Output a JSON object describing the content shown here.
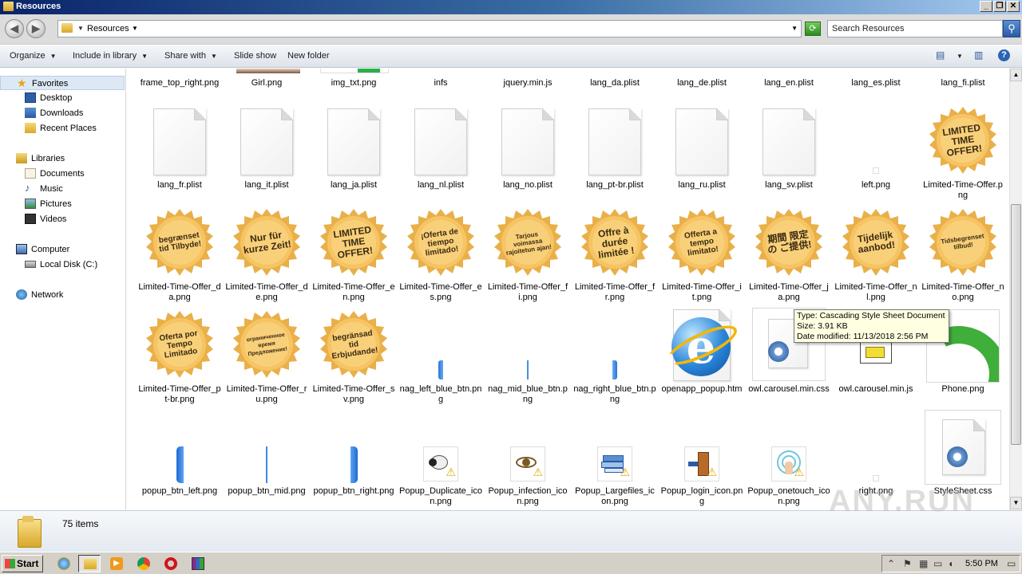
{
  "window": {
    "title": "Resources"
  },
  "address": {
    "crumb": "Resources",
    "search_placeholder": "Search Resources"
  },
  "toolbar": {
    "organize": "Organize",
    "include_in_library": "Include in library",
    "share_with": "Share with",
    "slide_show": "Slide show",
    "new_folder": "New folder"
  },
  "sidebar": {
    "favorites": "Favorites",
    "desktop": "Desktop",
    "downloads": "Downloads",
    "recent_places": "Recent Places",
    "libraries": "Libraries",
    "documents": "Documents",
    "music": "Music",
    "pictures": "Pictures",
    "videos": "Videos",
    "computer": "Computer",
    "local_disk": "Local Disk (C:)",
    "network": "Network"
  },
  "files": {
    "row0": [
      "frame_top_right.png",
      "Girl.png",
      "img_txt.png",
      "infs",
      "jquery.min.js",
      "lang_da.plist",
      "lang_de.plist",
      "lang_en.plist",
      "lang_es.plist",
      "lang_fi.plist"
    ],
    "row1": [
      "lang_fr.plist",
      "lang_it.plist",
      "lang_ja.plist",
      "lang_nl.plist",
      "lang_no.plist",
      "lang_pt-br.plist",
      "lang_ru.plist",
      "lang_sv.plist",
      "left.png",
      "Limited-Time-Offer.png"
    ],
    "row2": [
      "Limited-Time-Offer_da.png",
      "Limited-Time-Offer_de.png",
      "Limited-Time-Offer_en.png",
      "Limited-Time-Offer_es.png",
      "Limited-Time-Offer_fi.png",
      "Limited-Time-Offer_fr.png",
      "Limited-Time-Offer_it.png",
      "Limited-Time-Offer_ja.png",
      "Limited-Time-Offer_nl.png",
      "Limited-Time-Offer_no.png"
    ],
    "row3": [
      "Limited-Time-Offer_pt-br.png",
      "Limited-Time-Offer_ru.png",
      "Limited-Time-Offer_sv.png",
      "nag_left_blue_btn.png",
      "nag_mid_blue_btn.png",
      "nag_right_blue_btn.png",
      "openapp_popup.htm",
      "owl.carousel.min.css",
      "owl.carousel.min.js",
      "Phone.png"
    ],
    "row4": [
      "popup_btn_left.png",
      "popup_btn_mid.png",
      "popup_btn_right.png",
      "Popup_Duplicate_icon.png",
      "Popup_infection_icon.png",
      "Popup_Largefiles_icon.png",
      "Popup_login_icon.png",
      "Popup_onetouch_icon.png",
      "right.png",
      "StyleSheet.css"
    ]
  },
  "seals": {
    "main": "LIMITED TIME OFFER!",
    "row2": [
      "begrænset tid Tilbyde!",
      "Nur für kurze Zeit!",
      "LIMITED TIME OFFER!",
      "¡Oferta de tiempo limitado!",
      "Tarjous voimassa rajoitetun ajan!",
      "Offre à durée limitée !",
      "Offerta a tempo limitato!",
      "期間 限定の ご提供!",
      "Tijdelijk aanbod!",
      "Tidsbegrenset tilbud!"
    ],
    "row3": [
      "Oferta por Tempo Limitado",
      "ограниченное время Предложение!",
      "begränsad tid Erbjudande!"
    ]
  },
  "tooltip": {
    "type": "Type: Cascading Style Sheet Document",
    "size": "Size: 3.91 KB",
    "date": "Date modified: 11/13/2018 2:56 PM"
  },
  "status": {
    "item_count": "75 items"
  },
  "taskbar": {
    "start": "Start",
    "clock": "5:50 PM"
  },
  "watermark": "ANY.RUN"
}
